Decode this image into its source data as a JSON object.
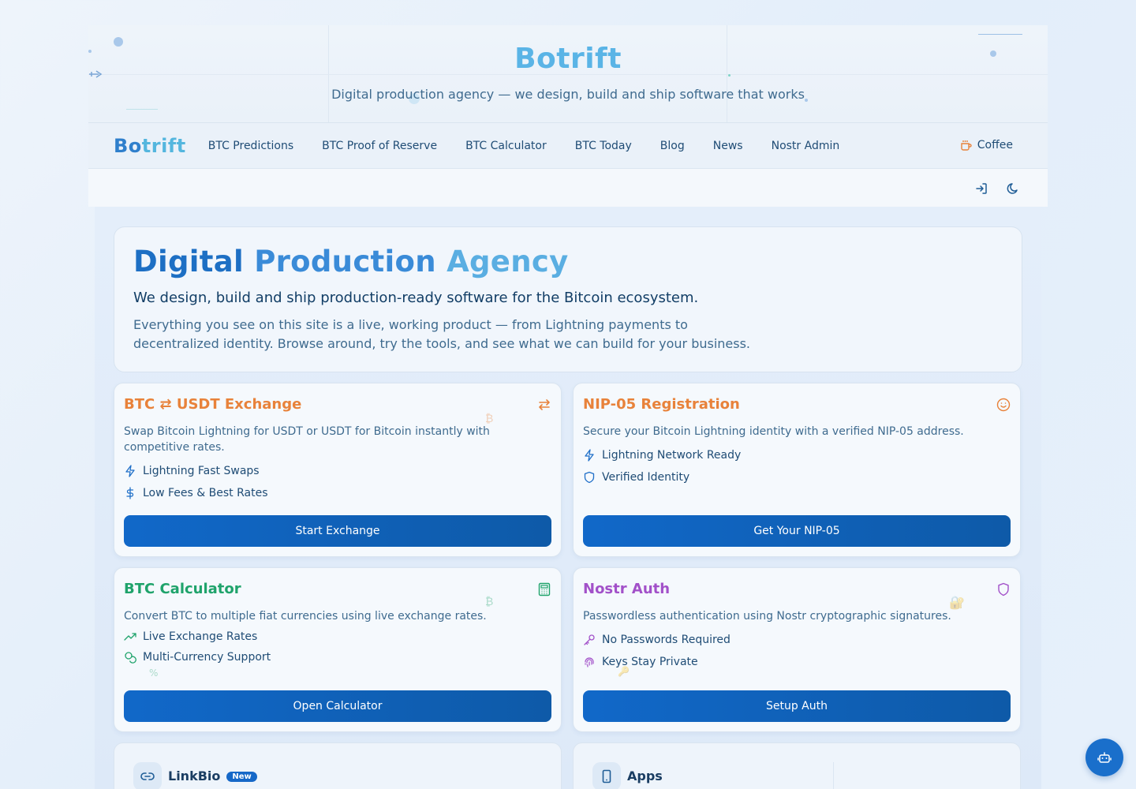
{
  "banner": {
    "title": "Botrift",
    "subtitle": "Digital production agency — we design, build and ship software that works"
  },
  "nav": {
    "brand_a": "Bo",
    "brand_b": "trift",
    "links": [
      "BTC Predictions",
      "BTC Proof of Reserve",
      "BTC Calculator",
      "BTC Today",
      "Blog",
      "News",
      "Nostr Admin"
    ],
    "coffee": "Coffee"
  },
  "toolbar": {
    "icons": [
      "login-icon",
      "moon-icon"
    ]
  },
  "hero": {
    "title_1": "Digital",
    "title_2": "Production",
    "title_3": "Agency",
    "lead": "We design, build and ship production-ready software for the Bitcoin ecosystem.",
    "description": "Everything you see on this site is a live, working product — from Lightning payments to decentralized identity. Browse around, try the tools, and see what we can build for your business."
  },
  "cards": [
    {
      "title": "BTC ⇄ USDT Exchange",
      "color": "#e8823a",
      "icon": "swap-icon",
      "description": "Swap Bitcoin Lightning for USDT or USDT for Bitcoin instantly with competitive rates.",
      "features": [
        "Lightning Fast Swaps",
        "Low Fees & Best Rates"
      ],
      "button": "Start Exchange"
    },
    {
      "title": "NIP-05 Registration",
      "color": "#e8823a",
      "icon": "smile-icon",
      "description": "Secure your Bitcoin Lightning identity with a verified NIP-05 address.",
      "features": [
        "Lightning Network Ready",
        "Verified Identity"
      ],
      "button": "Get Your NIP-05"
    },
    {
      "title": "BTC Calculator",
      "color": "#1fa36b",
      "icon": "calculator-icon",
      "description": "Convert BTC to multiple fiat currencies using live exchange rates.",
      "features": [
        "Live Exchange Rates",
        "Multi-Currency Support"
      ],
      "button": "Open Calculator"
    },
    {
      "title": "Nostr Auth",
      "color": "#a251c9",
      "icon": "shield-icon",
      "description": "Passwordless authentication using Nostr cryptographic signatures.",
      "features": [
        "No Passwords Required",
        "Keys Stay Private"
      ],
      "button": "Setup Auth"
    }
  ],
  "bottom_cards": [
    {
      "title": "LinkBio",
      "badge": "New",
      "icon": "link-icon"
    },
    {
      "title": "Apps",
      "icon": "smartphone-icon"
    }
  ],
  "colors": {
    "primary": "#1168c9",
    "orange": "#e8823a",
    "green": "#1fa36b",
    "purple": "#a251c9"
  }
}
